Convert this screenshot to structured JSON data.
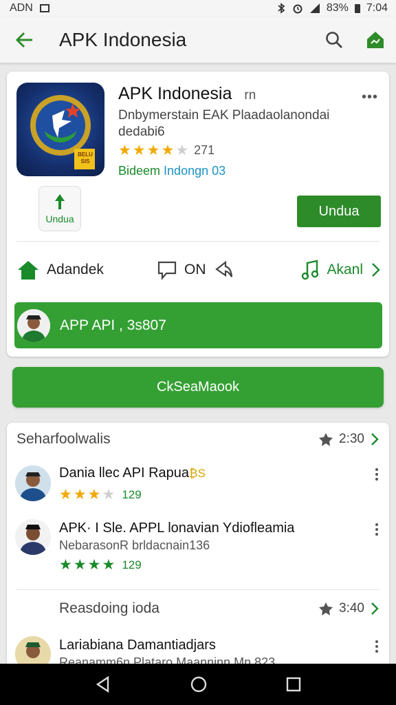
{
  "status_bar": {
    "left_text": "ADN",
    "battery": "83%",
    "time": "7:04"
  },
  "app_bar": {
    "title": "APK Indonesia"
  },
  "app": {
    "title": "APK Indonesia",
    "title_suffix": "rn",
    "description": "Dnbymerstain EAK Plaadaolanondai dedabi6",
    "rating_count": "271",
    "rating_stars": 4,
    "publisher_a": "Bideem",
    "publisher_b": "Indongn 03",
    "icon_badge": "BELU SIS",
    "small_install_label": "Undua",
    "install_label": "Undua"
  },
  "actions": {
    "home_label": "Adandek",
    "middle_label": "ON",
    "right_label": "Akanl"
  },
  "promo": {
    "text": "APP API , 3s807"
  },
  "main_button": {
    "label": "CkSeaMaook"
  },
  "section1": {
    "title": "Seharfoolwalis",
    "meta": "2:30",
    "items": [
      {
        "title": "Dania llec API Rapua",
        "title_extra": "₿S",
        "rating_stars": 3,
        "rating_count": "129",
        "sub": ""
      },
      {
        "title": "APK· I Sle. APPL lonavian Ydiofleamia",
        "title_extra": "",
        "sub": "NebarasonR brldacnain136",
        "rating_stars": 4,
        "rating_count": "129"
      }
    ]
  },
  "section2": {
    "title": "Reasdoing ioda",
    "meta": "3:40",
    "items": [
      {
        "title": "Lariabiana Damantiadjars",
        "sub": "Reanamm6n Plataro Maanninn Mn 823"
      }
    ]
  },
  "colors": {
    "accent": "#34a034",
    "accent_dark": "#2e8b2a",
    "star": "#f2a900",
    "link_blue": "#1a93c4"
  }
}
